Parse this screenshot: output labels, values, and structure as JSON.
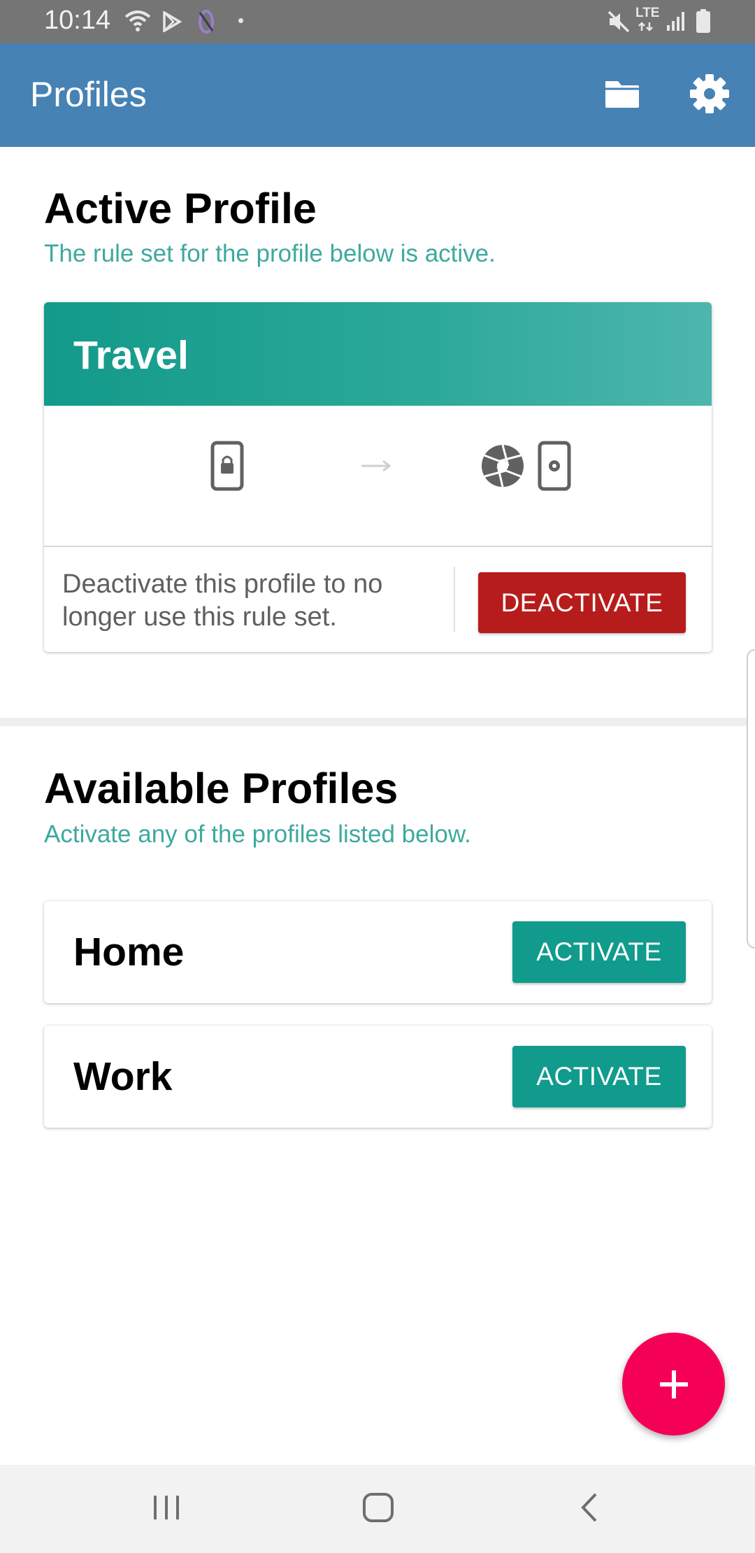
{
  "status_bar": {
    "time": "10:14",
    "network_label": "LTE"
  },
  "app_bar": {
    "title": "Profiles",
    "icons": [
      "folder-icon",
      "gear-icon"
    ],
    "color": "#4682b4"
  },
  "active_section": {
    "title": "Active Profile",
    "subtitle": "The rule set for the profile below is active.",
    "profile": {
      "name": "Travel",
      "rule_icons": [
        "phone-lock-icon",
        "arrow-right-icon",
        "camera-aperture-icon",
        "phone-camera-icon"
      ],
      "deactivate_text": "Deactivate this profile to no longer use this rule set.",
      "deactivate_label": "DEACTIVATE"
    }
  },
  "available_section": {
    "title": "Available Profiles",
    "subtitle": "Activate any of the profiles listed below.",
    "profiles": [
      {
        "name": "Home",
        "action_label": "ACTIVATE"
      },
      {
        "name": "Work",
        "action_label": "ACTIVATE"
      }
    ]
  },
  "fab": {
    "icon": "plus-icon",
    "color": "#f50057"
  },
  "nav_bar": {
    "buttons": [
      "recent-apps-icon",
      "home-icon",
      "back-icon"
    ]
  },
  "colors": {
    "accent": "#3ea99f",
    "activate": "#119b8c",
    "deactivate": "#b71c1c"
  }
}
